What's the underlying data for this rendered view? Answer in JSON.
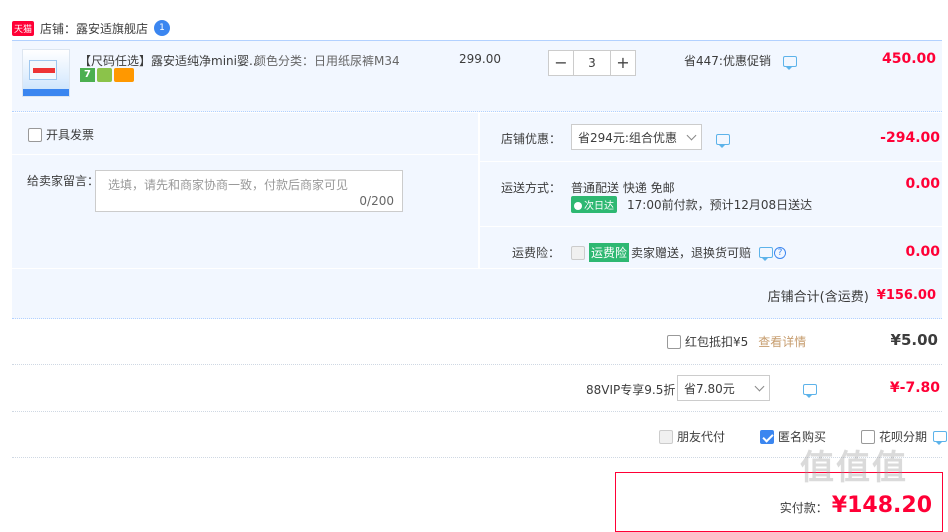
{
  "shop": {
    "badge": "天猫",
    "label": "店铺：",
    "name": "露安适旗舰店",
    "chat_dot": "1"
  },
  "item": {
    "title": "【尺码任选】露安适纯净mini婴...",
    "spec": "颜色分类：日用纸尿裤M34",
    "unit_price": "299.00",
    "quantity": "3",
    "promo": "省447:优惠促销",
    "total": "450.00",
    "badge7": "7"
  },
  "invoice": {
    "label": "开具发票"
  },
  "message": {
    "label": "给卖家留言：",
    "placeholder": "选填，请先和商家协商一致，付款后商家可见",
    "counter": "0/200"
  },
  "shop_discount": {
    "label": "店铺优惠：",
    "selected": "省294元:组合优惠",
    "amount": "-294.00"
  },
  "shipping": {
    "label": "运送方式：",
    "method": "普通配送 快递 免邮",
    "next_day_tag": "次日达",
    "eta": "17:00前付款，预计12月08日送达",
    "amount": "0.00"
  },
  "insurance": {
    "label": "运费险：",
    "tag": "运费险",
    "desc": "卖家赠送，退换货可赔",
    "amount": "0.00"
  },
  "shop_total": {
    "label": "店铺合计(含运费)",
    "amount": "¥156.00"
  },
  "red_packet": {
    "label": "红包抵扣¥5",
    "link": "查看详情",
    "amount": "¥5.00"
  },
  "vip": {
    "label": "88VIP专享9.5折",
    "selected": "省7.80元",
    "amount": "¥-7.80"
  },
  "options": {
    "friend_pay": "朋友代付",
    "anonymous": "匿名购买",
    "huabei": "花呗分期"
  },
  "final": {
    "label": "实付款：",
    "amount": "¥148.20"
  },
  "watermark": "值值值",
  "colors": {
    "accent_red": "#ff0036",
    "light_blue_bg": "#f2f7ff",
    "link_blue": "#3b86f0"
  }
}
